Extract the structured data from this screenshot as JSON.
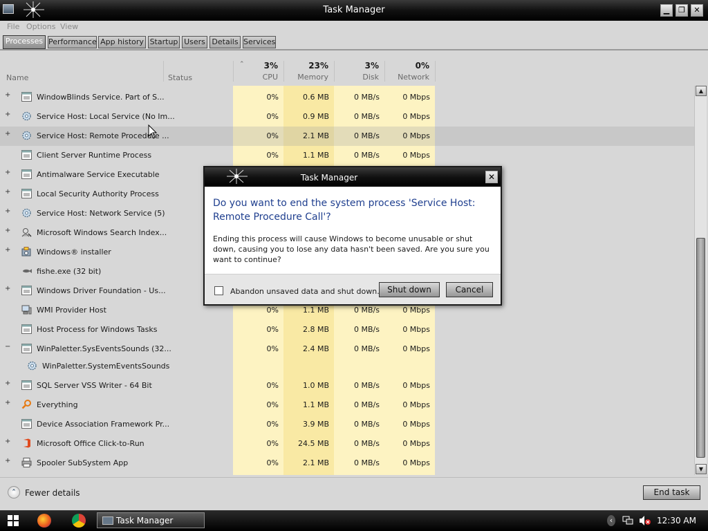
{
  "window": {
    "title": "Task Manager",
    "controls": {
      "minimize": "▁",
      "maximize": "❐",
      "close": "✕"
    }
  },
  "menu": [
    "File",
    "Options",
    "View"
  ],
  "tabs": [
    {
      "label": "Processes",
      "active": true
    },
    {
      "label": "Performance"
    },
    {
      "label": "App history"
    },
    {
      "label": "Startup"
    },
    {
      "label": "Users"
    },
    {
      "label": "Details"
    },
    {
      "label": "Services"
    }
  ],
  "columns": {
    "name": "Name",
    "status": "Status",
    "sort_indicator": "⌃",
    "cpu": {
      "pct": "3%",
      "label": "CPU"
    },
    "memory": {
      "pct": "23%",
      "label": "Memory"
    },
    "disk": {
      "pct": "3%",
      "label": "Disk"
    },
    "network": {
      "pct": "0%",
      "label": "Network"
    }
  },
  "processes": [
    {
      "name": "WindowBlinds Service.  Part of S...",
      "expander": "+",
      "icon": "service-icon",
      "cpu": "0%",
      "mem": "0.6 MB",
      "disk": "0 MB/s",
      "net": "0 Mbps"
    },
    {
      "name": "Service Host: Local Service (No Im...",
      "expander": "+",
      "icon": "gear-icon",
      "cpu": "0%",
      "mem": "0.9 MB",
      "disk": "0 MB/s",
      "net": "0 Mbps"
    },
    {
      "name": "Service Host: Remote Procedure ...",
      "expander": "+",
      "icon": "gear-icon",
      "cpu": "0%",
      "mem": "2.1 MB",
      "disk": "0 MB/s",
      "net": "0 Mbps",
      "selected": true
    },
    {
      "name": "Client Server Runtime Process",
      "expander": "",
      "icon": "window-icon",
      "cpu": "0%",
      "mem": "1.1 MB",
      "disk": "0 MB/s",
      "net": "0 Mbps"
    },
    {
      "name": "Antimalware Service Executable",
      "expander": "+",
      "icon": "window-icon",
      "cpu": "",
      "mem": "",
      "disk": "",
      "net": ""
    },
    {
      "name": "Local Security Authority Process",
      "expander": "+",
      "icon": "window-icon",
      "cpu": "",
      "mem": "",
      "disk": "",
      "net": ""
    },
    {
      "name": "Service Host: Network Service (5)",
      "expander": "+",
      "icon": "gear-icon",
      "cpu": "",
      "mem": "",
      "disk": "",
      "net": ""
    },
    {
      "name": "Microsoft Windows Search Index...",
      "expander": "+",
      "icon": "search-user-icon",
      "cpu": "",
      "mem": "",
      "disk": "",
      "net": ""
    },
    {
      "name": "Windows® installer",
      "expander": "+",
      "icon": "installer-icon",
      "cpu": "",
      "mem": "",
      "disk": "",
      "net": ""
    },
    {
      "name": "fishe.exe (32 bit)",
      "expander": "",
      "icon": "fish-icon",
      "cpu": "",
      "mem": "",
      "disk": "",
      "net": ""
    },
    {
      "name": "Windows Driver Foundation - Us...",
      "expander": "+",
      "icon": "window-icon",
      "cpu": "",
      "mem": "",
      "disk": "",
      "net": ""
    },
    {
      "name": "WMI Provider Host",
      "expander": "",
      "icon": "computer-icon",
      "cpu": "0%",
      "mem": "1.1 MB",
      "disk": "0 MB/s",
      "net": "0 Mbps"
    },
    {
      "name": "Host Process for Windows Tasks",
      "expander": "",
      "icon": "window-icon",
      "cpu": "0%",
      "mem": "2.8 MB",
      "disk": "0 MB/s",
      "net": "0 Mbps"
    },
    {
      "name": "WinPaletter.SysEventsSounds (32...",
      "expander": "−",
      "icon": "window-icon",
      "cpu": "0%",
      "mem": "2.4 MB",
      "disk": "0 MB/s",
      "net": "0 Mbps"
    },
    {
      "name": "WinPaletter.SystemEventsSounds",
      "expander": "",
      "icon": "gear-icon",
      "child": true,
      "cpu": "",
      "mem": "",
      "disk": "",
      "net": ""
    },
    {
      "name": "SQL Server VSS Writer - 64 Bit",
      "expander": "+",
      "icon": "window-icon",
      "cpu": "0%",
      "mem": "1.0 MB",
      "disk": "0 MB/s",
      "net": "0 Mbps"
    },
    {
      "name": "Everything",
      "expander": "+",
      "icon": "magnifier-icon",
      "cpu": "0%",
      "mem": "1.1 MB",
      "disk": "0 MB/s",
      "net": "0 Mbps"
    },
    {
      "name": "Device Association Framework Pr...",
      "expander": "",
      "icon": "window-icon",
      "cpu": "0%",
      "mem": "3.9 MB",
      "disk": "0 MB/s",
      "net": "0 Mbps"
    },
    {
      "name": "Microsoft Office Click-to-Run",
      "expander": "+",
      "icon": "office-icon",
      "cpu": "0%",
      "mem": "24.5 MB",
      "disk": "0 MB/s",
      "net": "0 Mbps"
    },
    {
      "name": "Spooler SubSystem App",
      "expander": "+",
      "icon": "printer-icon",
      "cpu": "0%",
      "mem": "2.1 MB",
      "disk": "0 MB/s",
      "net": "0 Mbps"
    }
  ],
  "footer": {
    "fewer_details": "Fewer details",
    "fewer_icon": "⌃",
    "end_task": "End task"
  },
  "dialog": {
    "title": "Task Manager",
    "close": "✕",
    "question": "Do you want to end the system process 'Service Host: Remote Procedure Call'?",
    "body": "Ending this process will cause Windows to become unusable or shut down, causing you to lose any data hasn't been saved. Are you sure you want to continue?",
    "checkbox_label": "Abandon unsaved data and shut down.",
    "shutdown_button": "Shut down",
    "cancel_button": "Cancel"
  },
  "taskbar": {
    "task_label": "Task Manager",
    "clock": "12:30 AM",
    "tray_chevron": "‹"
  },
  "colors": {
    "highlight_column": "#fdf3c2",
    "memory_column": "#f9e9a4",
    "dialog_question": "#1f3f8f"
  }
}
